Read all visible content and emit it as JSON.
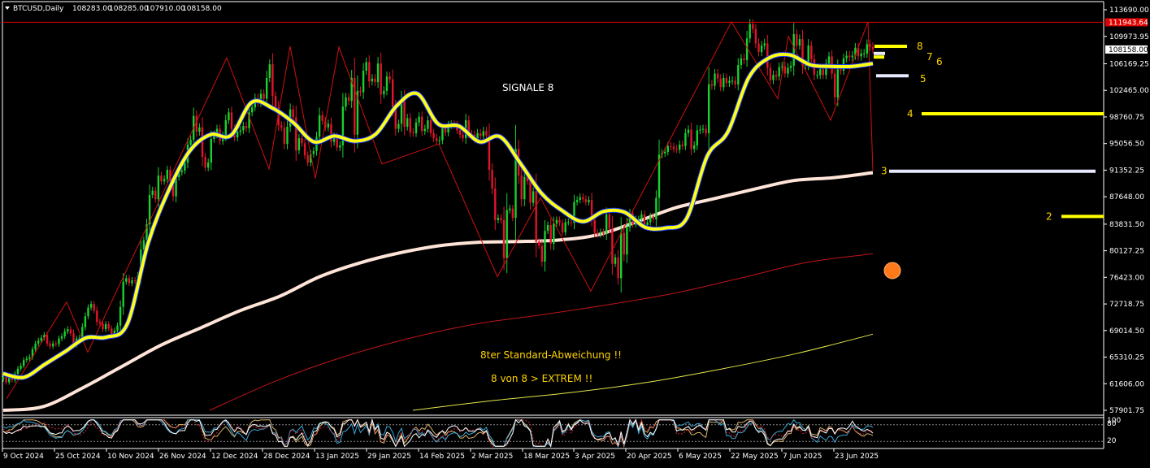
{
  "header": {
    "symbol": "BTCUSD,Daily",
    "open": "108283.00",
    "high": "108285.00",
    "low": "107910.00",
    "close": "108158.00"
  },
  "colors": {
    "background": "#000000",
    "bull": "#19d12f",
    "bear": "#e0142a",
    "ma_fast": "#ffff14",
    "ma_fast_inner": "#1a3cff",
    "ma_slow": "#ffe4d8",
    "std_red": "#c0151a",
    "std_yellow": "#e5e64a",
    "zigzag": "#d01010",
    "resistance": "#e00000",
    "level_yellow": "#ffff00",
    "level_white": "#e8e8ff",
    "dot": "#ff7a1a",
    "text_yellow": "#ffd400"
  },
  "annotations": {
    "signal": "SIGNALE 8",
    "std_dev": "8ter Standard-Abweichung !!",
    "extreme": "8 von 8 > EXTREM !!"
  },
  "chart_data": {
    "type": "candlestick",
    "title": "BTCUSD,Daily",
    "ylim": [
      57000,
      114500
    ],
    "y_ticks": [
      "113690.00",
      "109973.95",
      "106169.25",
      "102465.00",
      "98760.75",
      "95056.50",
      "91352.25",
      "87648.00",
      "83831.50",
      "80127.25",
      "76423.00",
      "72718.75",
      "69014.50",
      "65310.25",
      "61606.00",
      "57901.75"
    ],
    "x_labels": [
      "9 Oct 2024",
      "25 Oct 2024",
      "10 Nov 2024",
      "26 Nov 2024",
      "12 Dec 2024",
      "28 Dec 2024",
      "13 Jan 2025",
      "29 Jan 2025",
      "14 Feb 2025",
      "2 Mar 2025",
      "18 Mar 2025",
      "3 Apr 2025",
      "20 Apr 2025",
      "6 May 2025",
      "22 May 2025",
      "7 Jun 2025",
      "23 Jun 2025"
    ],
    "price_tags": [
      {
        "label": "111943.64",
        "value": 111943.64,
        "color": "#e00000"
      },
      {
        "label": "108158.00",
        "value": 108158.0,
        "color": "#ffffff"
      }
    ],
    "resistance_level": 111943.64,
    "signal_levels": [
      {
        "label": "8",
        "value": 108600
      },
      {
        "label": "7",
        "value": 107600
      },
      {
        "label": "6",
        "value": 107100
      },
      {
        "label": "5",
        "value": 104500
      },
      {
        "label": "4",
        "value": 99200
      },
      {
        "label": "3",
        "value": 91200
      },
      {
        "label": "2",
        "value": 84900
      }
    ],
    "closes": [
      62500,
      61800,
      62400,
      62100,
      63000,
      63700,
      64100,
      64900,
      65100,
      65300,
      66400,
      67200,
      67600,
      68000,
      68400,
      67200,
      66800,
      67200,
      67100,
      67900,
      68200,
      68900,
      69200,
      68600,
      67000,
      67900,
      68000,
      69500,
      71000,
      72200,
      72700,
      71800,
      70200,
      70000,
      69200,
      69900,
      69300,
      68300,
      69000,
      69700,
      72300,
      75800,
      76300,
      75600,
      76000,
      75900,
      76700,
      80300,
      81600,
      83800,
      87900,
      88500,
      87300,
      90600,
      89800,
      90100,
      91400,
      89900,
      87700,
      90400,
      91100,
      91300,
      92400,
      94900,
      95600,
      98900,
      96700,
      97300,
      93200,
      91700,
      92400,
      95700,
      96300,
      97100,
      95400,
      96100,
      98300,
      99400,
      97100,
      95900,
      96700,
      96900,
      97500,
      97200,
      99400,
      100100,
      101400,
      100700,
      102000,
      101300,
      104200,
      106100,
      101700,
      100100,
      97600,
      97300,
      95000,
      97400,
      99800,
      98700,
      94100,
      95800,
      95100,
      93400,
      92400,
      93600,
      94000,
      96000,
      99000,
      98200,
      97300,
      97800,
      95300,
      96000,
      94500,
      94800,
      100200,
      101500,
      101000,
      104200,
      96300,
      102400,
      102200,
      105200,
      106400,
      103700,
      104100,
      103600,
      106200,
      101900,
      102400,
      104400,
      104000,
      100100,
      97100,
      97800,
      101200,
      97400,
      98600,
      96600,
      96500,
      98000,
      98800,
      96800,
      97100,
      98300,
      96500,
      95800,
      95400,
      95500,
      97200,
      96600,
      97600,
      97700,
      97600,
      96900,
      96300,
      95800,
      98300,
      96400,
      96300,
      95700,
      96500,
      96100,
      96800,
      96200,
      91400,
      88800,
      84400,
      84700,
      84400,
      79100,
      85800,
      86000,
      84700,
      94300,
      90600,
      87300,
      90400,
      89800,
      86800,
      88400,
      81400,
      80800,
      78600,
      82900,
      83700,
      81100,
      83900,
      84400,
      84000,
      82700,
      84100,
      84100,
      84000,
      86900,
      87200,
      87600,
      87300,
      86900,
      87200,
      84400,
      82600,
      82400,
      82700,
      82500,
      85200,
      83200,
      78300,
      79200,
      76300,
      82600,
      79600,
      83400,
      85300,
      83800,
      84500,
      84500,
      85200,
      83700,
      84100,
      84900,
      84500,
      87500,
      93500,
      93700,
      93900,
      94700,
      94600,
      94300,
      94200,
      94900,
      94700,
      96500,
      97000,
      94300,
      94800,
      96900,
      97000,
      97100,
      96500,
      103300,
      103100,
      104800,
      104100,
      102900,
      104200,
      103500,
      103800,
      103800,
      103300,
      106000,
      106900,
      106700,
      109700,
      111700,
      111000,
      109000,
      107800,
      108700,
      109000,
      105600,
      103900,
      104600,
      104400,
      105700,
      105800,
      104800,
      105600,
      105900,
      110300,
      108700,
      109600,
      105900,
      106100,
      108700,
      106800,
      104600,
      104600,
      105400,
      104600,
      106200,
      107200,
      104800,
      101500,
      105400,
      105200,
      106900,
      107300,
      107100,
      107300,
      108400,
      107200,
      107600,
      107600,
      108900,
      108500,
      108200
    ],
    "ma_fast_anchor_values": [
      63000,
      62500,
      64300,
      66100,
      68000,
      68100,
      70000,
      81200,
      88600,
      94000,
      96300,
      96200,
      100800,
      100000,
      98000,
      95300,
      96100,
      95400,
      96400,
      100300,
      102000,
      97800,
      97500,
      95300,
      96000,
      92200,
      88100,
      85700,
      84200,
      85600,
      85500,
      83400,
      83300,
      84600,
      93300,
      96700,
      104200,
      107000,
      107400,
      106000,
      105800,
      105800,
      106200
    ],
    "ma_slow_anchor_values": [
      57901.75,
      58400,
      61000,
      64000,
      67000,
      69400,
      71800,
      73800,
      76500,
      78400,
      79800,
      80800,
      81300,
      81400,
      81600,
      82300,
      84100,
      86100,
      87400,
      88700,
      89900,
      90300,
      91000
    ],
    "std_red_anchor_values": [
      57901.75,
      62000,
      65300,
      67900,
      69900,
      71200,
      72600,
      74200,
      76300,
      78500,
      79700
    ],
    "std_yellow_anchor_values": [
      57901.75,
      59200,
      60300,
      61700,
      63600,
      65800,
      68500
    ],
    "zigzag_values": [
      59500,
      73000,
      66000,
      107000,
      91500,
      108600,
      90200,
      108500,
      92200,
      95000,
      76500,
      87500,
      74500,
      112000,
      101300,
      110000,
      98300,
      112000,
      91200
    ],
    "oscillator": {
      "labels": [
        "100",
        "80",
        "20"
      ]
    }
  }
}
